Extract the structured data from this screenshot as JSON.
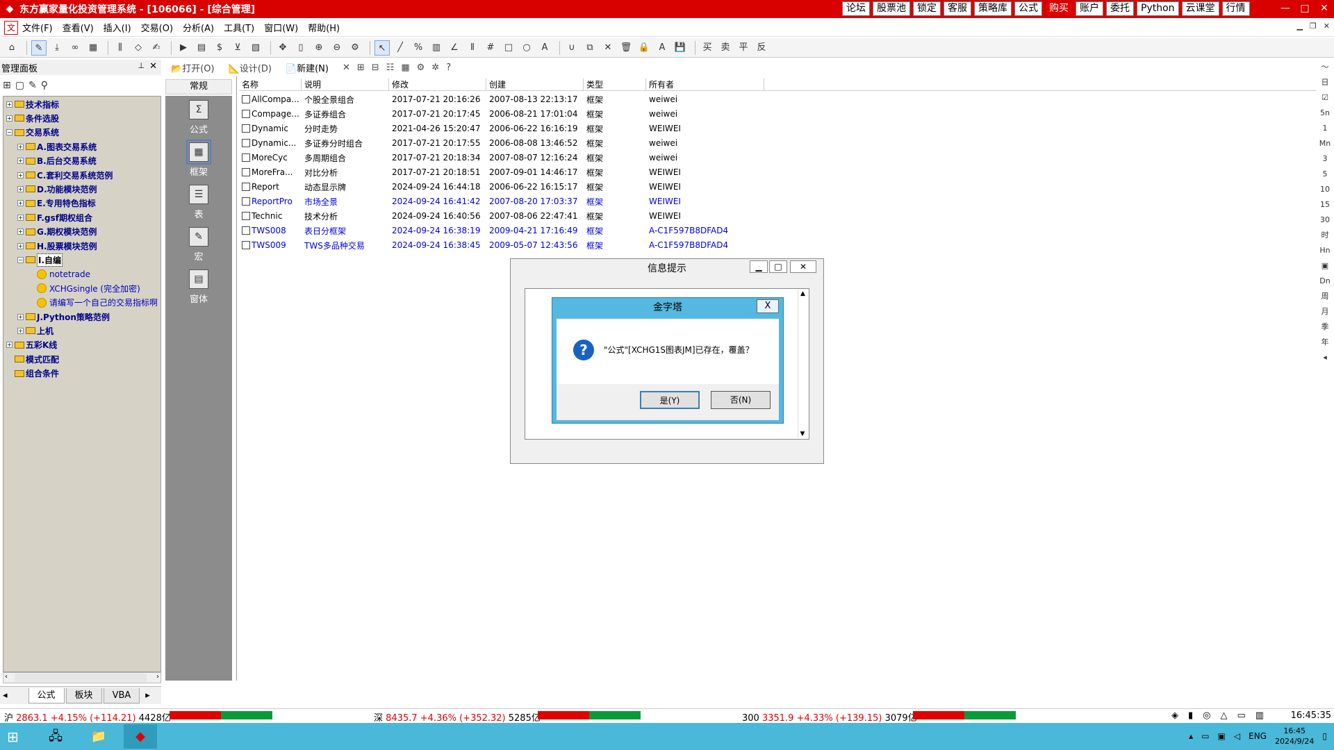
{
  "window": {
    "title": "东方赢家量化投资管理系统 - [106066] - [综合管理]",
    "top_buttons": [
      {
        "label": "论坛",
        "red": false
      },
      {
        "label": "股票池",
        "red": false
      },
      {
        "label": "锁定",
        "red": false
      },
      {
        "label": "客服",
        "red": false
      },
      {
        "label": "策略库",
        "red": false
      },
      {
        "label": "公式",
        "red": false
      },
      {
        "label": "购买",
        "red": true
      },
      {
        "label": "账户",
        "red": false
      },
      {
        "label": "委托",
        "red": false
      },
      {
        "label": "Python",
        "red": false
      },
      {
        "label": "云课堂",
        "red": false
      },
      {
        "label": "行情",
        "red": false
      }
    ],
    "controls": [
      "—",
      "□",
      "✕"
    ]
  },
  "menubar": {
    "items": [
      "文件(F)",
      "查看(V)",
      "插入(I)",
      "交易(O)",
      "分析(A)",
      "工具(T)",
      "窗口(W)",
      "帮助(H)"
    ]
  },
  "panel": {
    "title": "管理面板",
    "tree": [
      {
        "label": "技术指标",
        "level": 0,
        "exp": "+",
        "type": "folder"
      },
      {
        "label": "条件选股",
        "level": 0,
        "exp": "+",
        "type": "folder"
      },
      {
        "label": "交易系统",
        "level": 0,
        "exp": "−",
        "type": "folder"
      },
      {
        "label": "A.图表交易系统",
        "level": 1,
        "exp": "+",
        "type": "folder"
      },
      {
        "label": "B.后台交易系统",
        "level": 1,
        "exp": "+",
        "type": "folder"
      },
      {
        "label": "C.套利交易系统范例",
        "level": 1,
        "exp": "+",
        "type": "folder"
      },
      {
        "label": "D.功能模块范例",
        "level": 1,
        "exp": "+",
        "type": "folder"
      },
      {
        "label": "E.专用特色指标",
        "level": 1,
        "exp": "+",
        "type": "folder"
      },
      {
        "label": "F.gsf期权组合",
        "level": 1,
        "exp": "+",
        "type": "folder"
      },
      {
        "label": "G.期权模块范例",
        "level": 1,
        "exp": "+",
        "type": "folder"
      },
      {
        "label": "H.股票模块范例",
        "level": 1,
        "exp": "+",
        "type": "folder"
      },
      {
        "label": "I.自编",
        "level": 1,
        "exp": "−",
        "type": "folder",
        "selected": true
      },
      {
        "label": "notetrade",
        "level": 2,
        "exp": "",
        "type": "leaf"
      },
      {
        "label": "XCHGsingle (完全加密)",
        "level": 2,
        "exp": "",
        "type": "leaf"
      },
      {
        "label": "请编写一个自己的交易指标啊",
        "level": 2,
        "exp": "",
        "type": "leaf"
      },
      {
        "label": "J.Python策略范例",
        "level": 1,
        "exp": "+",
        "type": "folder"
      },
      {
        "label": "上机",
        "level": 1,
        "exp": "+",
        "type": "folder"
      },
      {
        "label": "五彩K线",
        "level": 0,
        "exp": "+",
        "type": "folder"
      },
      {
        "label": "模式匹配",
        "level": 0,
        "exp": "",
        "type": "folder"
      },
      {
        "label": "组合条件",
        "level": 0,
        "exp": "",
        "type": "folder"
      }
    ],
    "tabs": [
      "公式",
      "板块",
      "VBA"
    ]
  },
  "subtoolbar": {
    "open": "打开(O)",
    "design": "设计(D)",
    "new": "新建(N)"
  },
  "categories": {
    "header": "常规",
    "items": [
      {
        "label": "公式",
        "icon": "Σ"
      },
      {
        "label": "框架",
        "icon": "▦"
      },
      {
        "label": "表",
        "icon": "☰"
      },
      {
        "label": "宏",
        "icon": "✎"
      },
      {
        "label": "窗体",
        "icon": "▤"
      }
    ]
  },
  "list": {
    "headers": [
      "名称",
      "说明",
      "修改",
      "创建",
      "类型",
      "所有者"
    ],
    "rows": [
      {
        "name": "AllCompa...",
        "desc": "个股全景组合",
        "mod": "2017-07-21 20:16:26",
        "created": "2007-08-13 22:13:17",
        "type": "框架",
        "owner": "weiwei",
        "blue": false
      },
      {
        "name": "Compage...",
        "desc": "多证券组合",
        "mod": "2017-07-21 20:17:45",
        "created": "2006-08-21 17:01:04",
        "type": "框架",
        "owner": "weiwei",
        "blue": false
      },
      {
        "name": "Dynamic",
        "desc": "分时走势",
        "mod": "2021-04-26 15:20:47",
        "created": "2006-06-22 16:16:19",
        "type": "框架",
        "owner": "WEIWEI",
        "blue": false
      },
      {
        "name": "Dynamic...",
        "desc": "多证券分时组合",
        "mod": "2017-07-21 20:17:55",
        "created": "2006-08-08 13:46:52",
        "type": "框架",
        "owner": "weiwei",
        "blue": false
      },
      {
        "name": "MoreCyc",
        "desc": "多周期组合",
        "mod": "2017-07-21 20:18:34",
        "created": "2007-08-07 12:16:24",
        "type": "框架",
        "owner": "weiwei",
        "blue": false
      },
      {
        "name": "MoreFra...",
        "desc": "对比分析",
        "mod": "2017-07-21 20:18:51",
        "created": "2007-09-01 14:46:17",
        "type": "框架",
        "owner": "WEIWEI",
        "blue": false
      },
      {
        "name": "Report",
        "desc": "动态显示牌",
        "mod": "2024-09-24 16:44:18",
        "created": "2006-06-22 16:15:17",
        "type": "框架",
        "owner": "WEIWEI",
        "blue": false
      },
      {
        "name": "ReportPro",
        "desc": "市场全景",
        "mod": "2024-09-24 16:41:42",
        "created": "2007-08-20 17:03:37",
        "type": "框架",
        "owner": "WEIWEI",
        "blue": true
      },
      {
        "name": "Technic",
        "desc": "技术分析",
        "mod": "2024-09-24 16:40:56",
        "created": "2007-08-06 22:47:41",
        "type": "框架",
        "owner": "WEIWEI",
        "blue": false
      },
      {
        "name": "TWS008",
        "desc": "表日分框架",
        "mod": "2024-09-24 16:38:19",
        "created": "2009-04-21 17:16:49",
        "type": "框架",
        "owner": "A-C1F597B8DFAD4",
        "blue": true
      },
      {
        "name": "TWS009",
        "desc": "TWS多品种交易",
        "mod": "2024-09-24 16:38:45",
        "created": "2009-05-07 12:43:56",
        "type": "框架",
        "owner": "A-C1F597B8DFAD4",
        "blue": true
      }
    ]
  },
  "dialog_outer": {
    "title": "信息提示"
  },
  "dialog_inner": {
    "title": "金字塔",
    "close": "X",
    "message": "\"公式\"[XCHG1S图表JM]已存在，覆盖？",
    "yes": "是(Y)",
    "no": "否(N)"
  },
  "right_strip": [
    "〜",
    "日",
    "☑",
    "5n",
    "1",
    "Mn",
    "3",
    "5",
    "10",
    "15",
    "30",
    "时",
    "Hn",
    "▣",
    "Dn",
    "周",
    "月",
    "季",
    "年",
    "◂"
  ],
  "status": {
    "sh_label": "沪",
    "sh_value": "2863.1 +4.15% (+114.21)",
    "sh_amount": "4428亿",
    "sz_label": "深",
    "sz_value": "8435.7 +4.36% (+352.32)",
    "sz_amount": "5285亿",
    "i300_label": "300",
    "i300_value": "3351.9 +4.33% (+139.15)",
    "i300_amount": "3079亿",
    "clock": "16:45:35"
  },
  "taskbar": {
    "lang": "ENG",
    "time": "16:45",
    "date": "2024/9/24"
  },
  "colors": {
    "title_red": "#d90000",
    "up_red": "#e00000",
    "down_green": "#0a9a3a",
    "taskbar": "#4ab8d8"
  }
}
